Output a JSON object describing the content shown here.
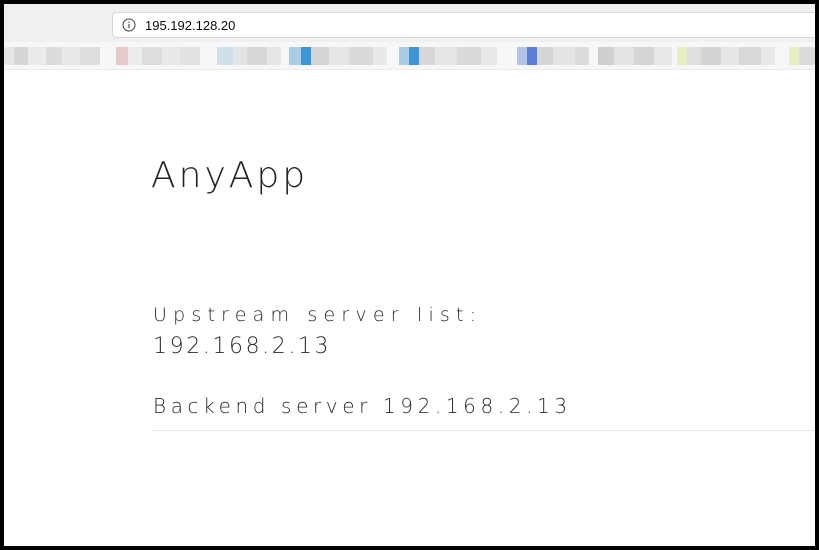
{
  "browser": {
    "address_bar": {
      "url": "195.192.128.20",
      "icon": "info-icon"
    },
    "bookmarks_bar": {
      "blurred": true
    }
  },
  "page": {
    "app_title": "AnyApp",
    "upstream_label": "Upstream server list:",
    "upstream_value": "192.168.2.13",
    "backend_text": "Backend server 192.168.2.13"
  },
  "colors": {
    "text": "#2a2a2a",
    "frame_border": "#000000",
    "chrome_bg": "#f0f0f2",
    "divider": "#e6e6e6"
  }
}
